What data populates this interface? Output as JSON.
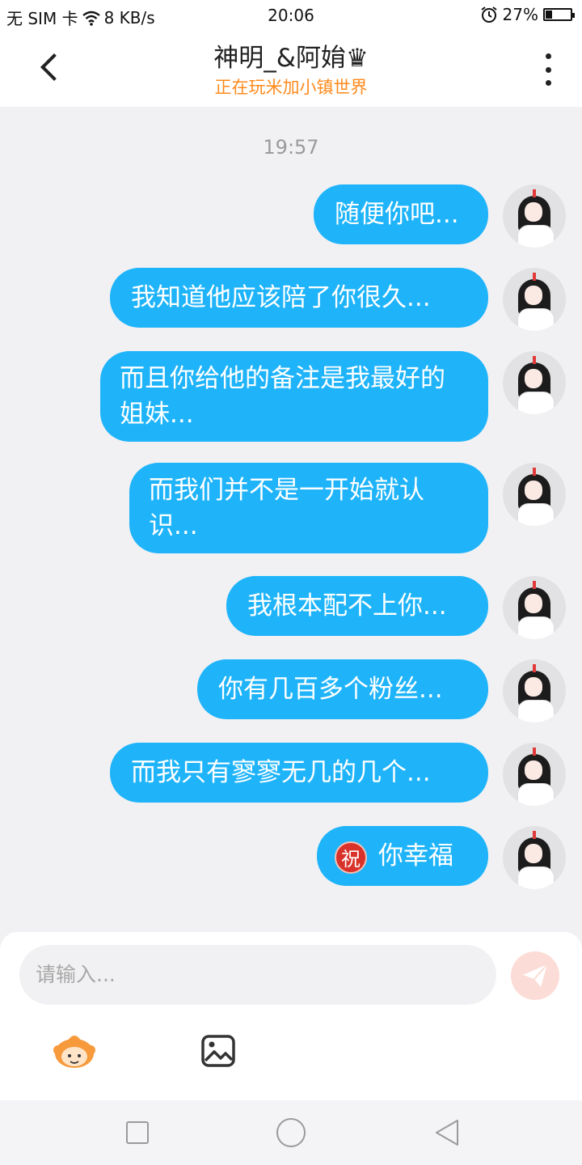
{
  "status_bar": {
    "carrier": "无 SIM 卡",
    "network_speed": "8 KB/s",
    "time": "20:06",
    "battery": "27%",
    "battery_level": 0.27
  },
  "header": {
    "title": "神明_&阿姢♛",
    "subtitle": "正在玩米加小镇世界"
  },
  "chat": {
    "timestamp": "19:57",
    "messages": [
      {
        "text": "随便你吧..."
      },
      {
        "text": "我知道他应该陪了你很久..."
      },
      {
        "text": "而且你给他的备注是我最好的姐妹..."
      },
      {
        "text": "而我们并不是一开始就认识..."
      },
      {
        "text": "我根本配不上你..."
      },
      {
        "text": "你有几百多个粉丝..."
      },
      {
        "text": "而我只有寥寥无几的几个..."
      },
      {
        "text": "你幸福",
        "badge": "祝"
      }
    ]
  },
  "input": {
    "placeholder": "请输入..."
  },
  "icons": {
    "back": "chevron-left-icon",
    "more": "more-vertical-icon",
    "send": "send-icon",
    "emoji": "emoji-icon",
    "image": "image-icon"
  },
  "colors": {
    "bubble": "#1fb4fa",
    "subtitle": "#ff8a1c",
    "send_button": "#fcdcd6"
  }
}
